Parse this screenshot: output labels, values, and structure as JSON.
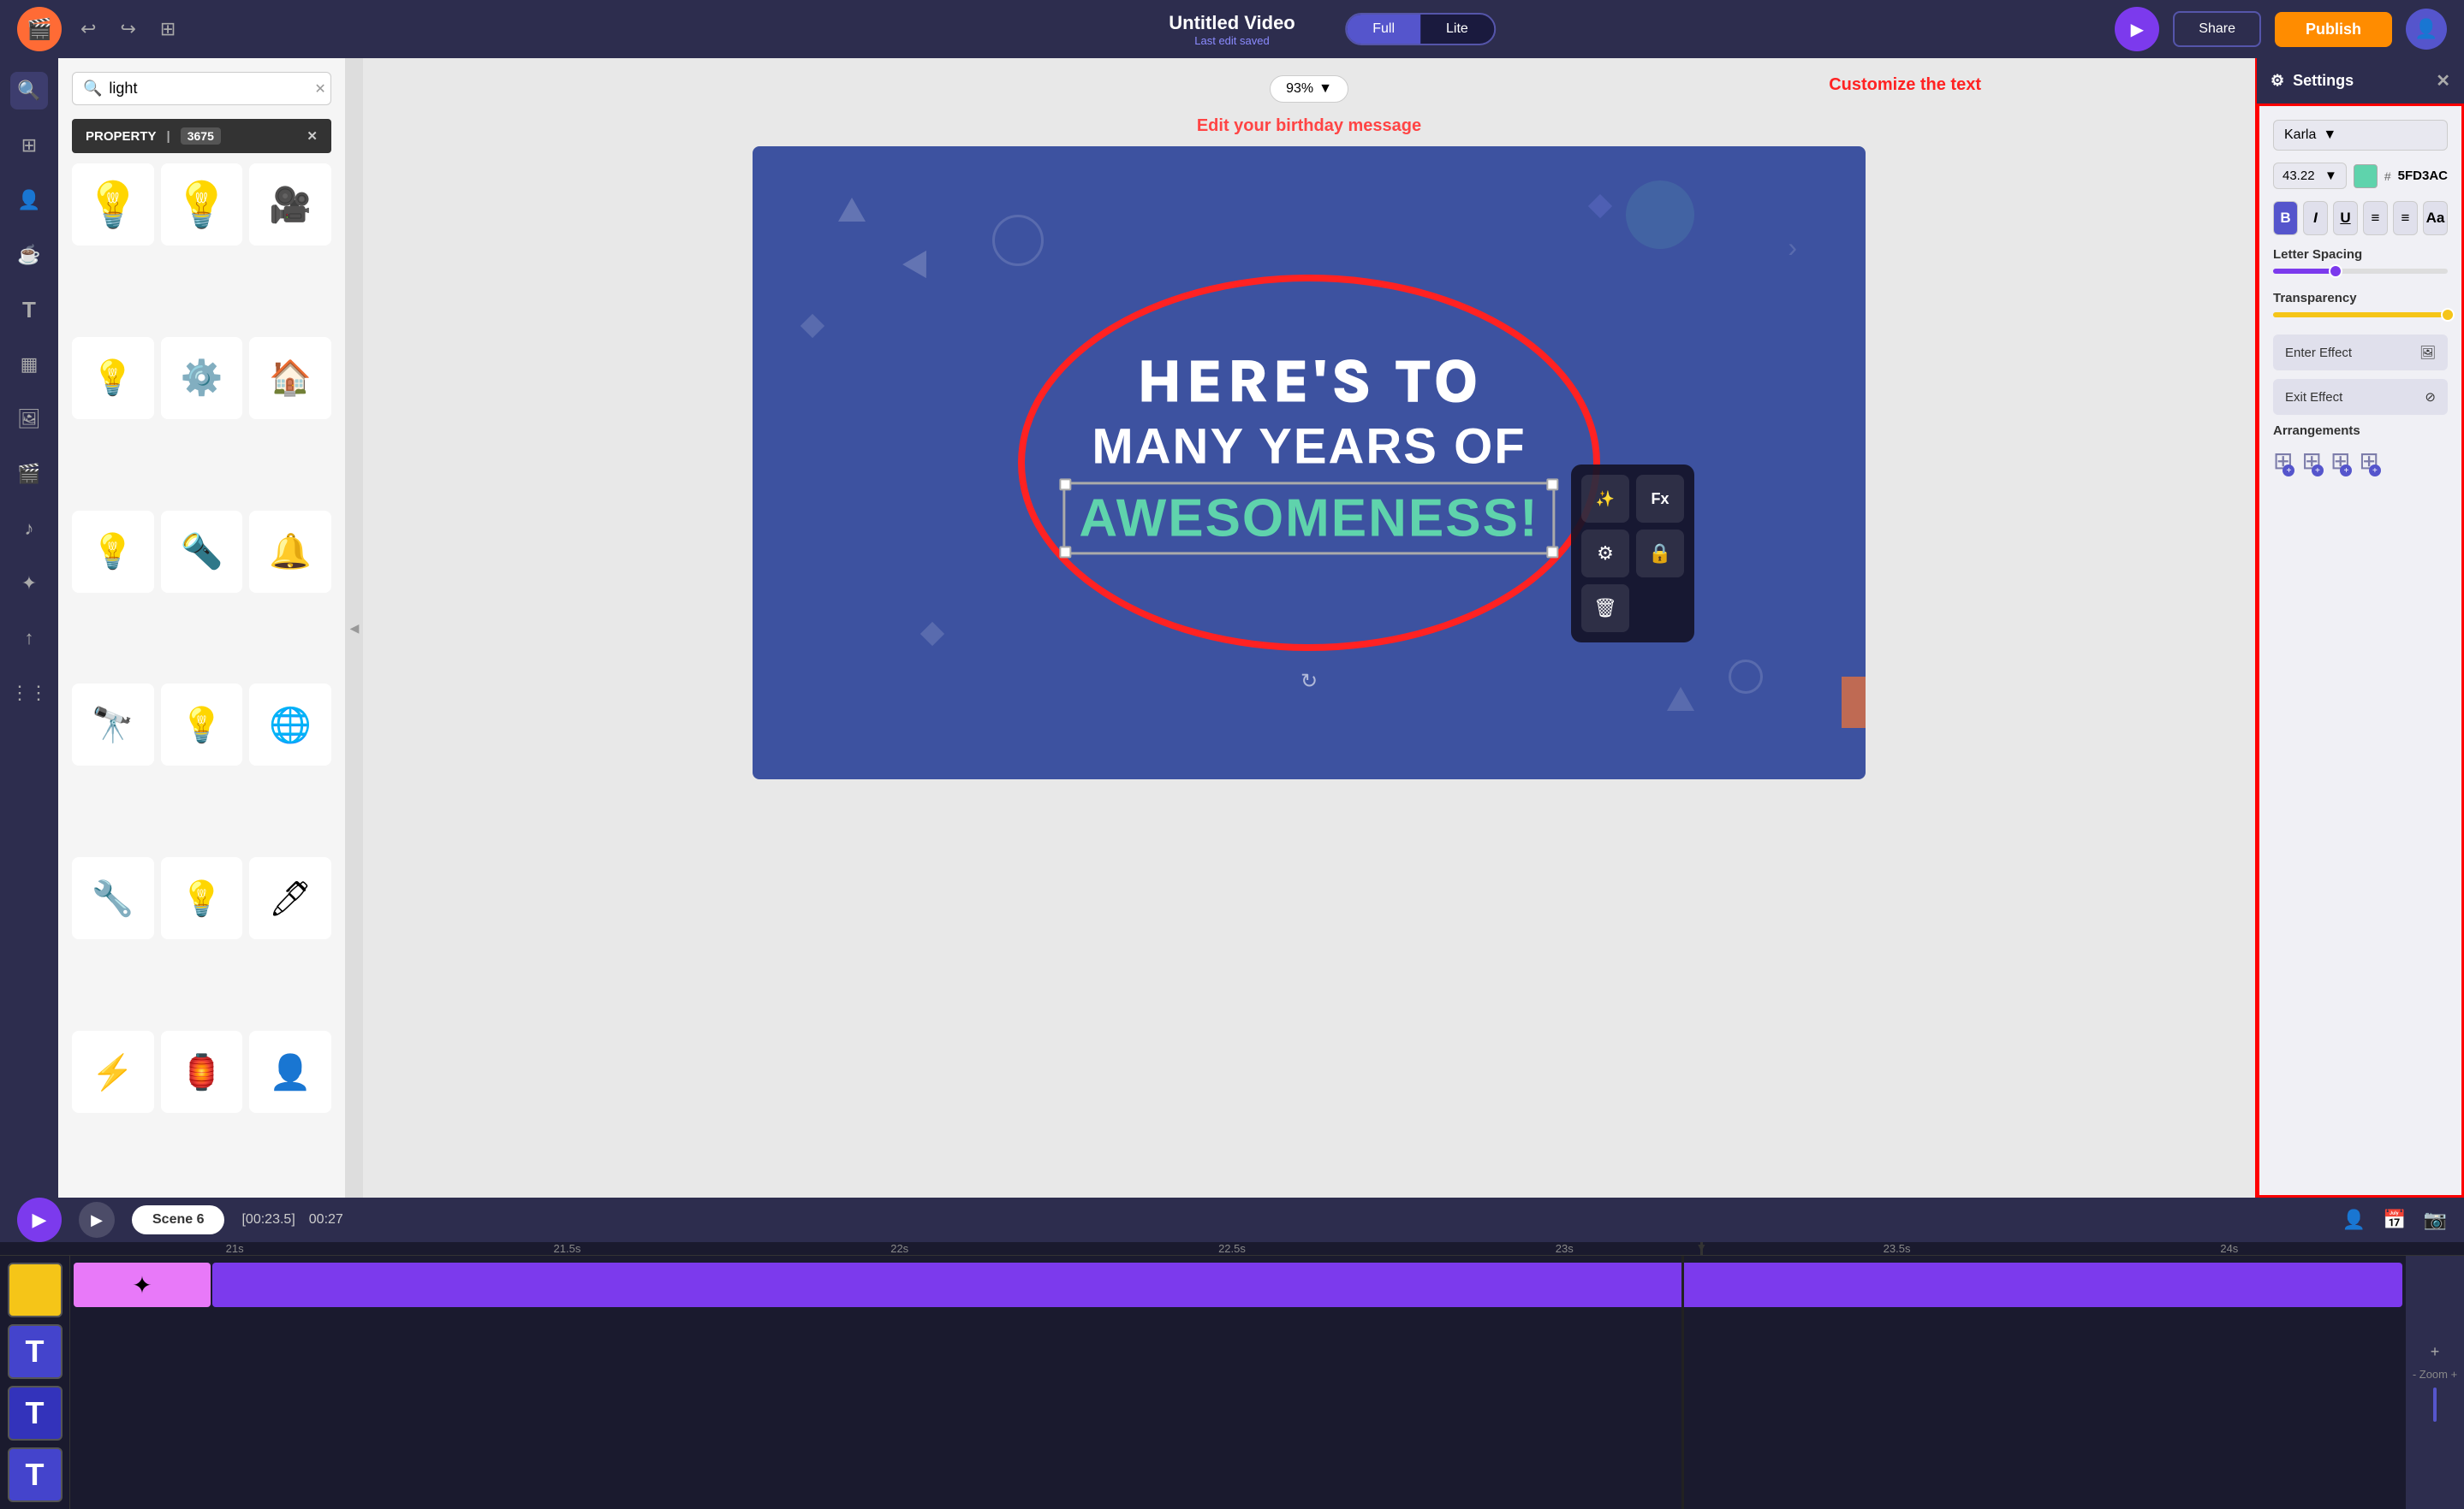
{
  "topbar": {
    "title": "Untitled Video",
    "subtitle": "Last edit saved",
    "mode_full": "Full",
    "mode_lite": "Lite",
    "share_label": "Share",
    "publish_label": "Publish",
    "zoom_value": "93%"
  },
  "search_panel": {
    "search_placeholder": "light",
    "search_value": "light",
    "property_label": "PROPERTY",
    "property_count": "3675"
  },
  "canvas": {
    "edit_label": "Edit your birthday message",
    "customize_label": "Customize the text",
    "line1": "HERE'S TO",
    "line2": "MANY YEARS OF",
    "line3": "AWESOMENESS!",
    "line3_color": "#5FD3AC"
  },
  "settings": {
    "title": "Settings",
    "font_name": "Karla",
    "font_size": "43.22",
    "color_hex": "5FD3AC",
    "letter_spacing_label": "Letter Spacing",
    "transparency_label": "Transparency",
    "enter_effect_label": "Enter Effect",
    "exit_effect_label": "Exit Effect",
    "arrangements_label": "Arrangements"
  },
  "timeline": {
    "scene_label": "Scene 6",
    "time_current": "[00:23.5]",
    "time_total": "00:27",
    "ruler_marks": [
      "21s",
      "21.5s",
      "22s",
      "22.5s",
      "23s",
      "23.5s",
      "24s"
    ],
    "zoom_label": "- Zoom +"
  },
  "sidebar_icons": [
    {
      "name": "search",
      "symbol": "🔍"
    },
    {
      "name": "layers",
      "symbol": "⊞"
    },
    {
      "name": "person",
      "symbol": "👤"
    },
    {
      "name": "coffee",
      "symbol": "☕"
    },
    {
      "name": "text",
      "symbol": "T"
    },
    {
      "name": "background",
      "symbol": "▦"
    },
    {
      "name": "image",
      "symbol": "🖼"
    },
    {
      "name": "film",
      "symbol": "🎬"
    },
    {
      "name": "music",
      "symbol": "♪"
    },
    {
      "name": "effects",
      "symbol": "✦"
    },
    {
      "name": "upload",
      "symbol": "↑"
    },
    {
      "name": "grid",
      "symbol": "⊞"
    }
  ],
  "asset_row": [
    {
      "type": "yellow",
      "symbol": ""
    },
    {
      "type": "blue",
      "symbol": "T"
    },
    {
      "type": "blue2",
      "symbol": "T"
    },
    {
      "type": "blue3",
      "symbol": "T"
    }
  ]
}
